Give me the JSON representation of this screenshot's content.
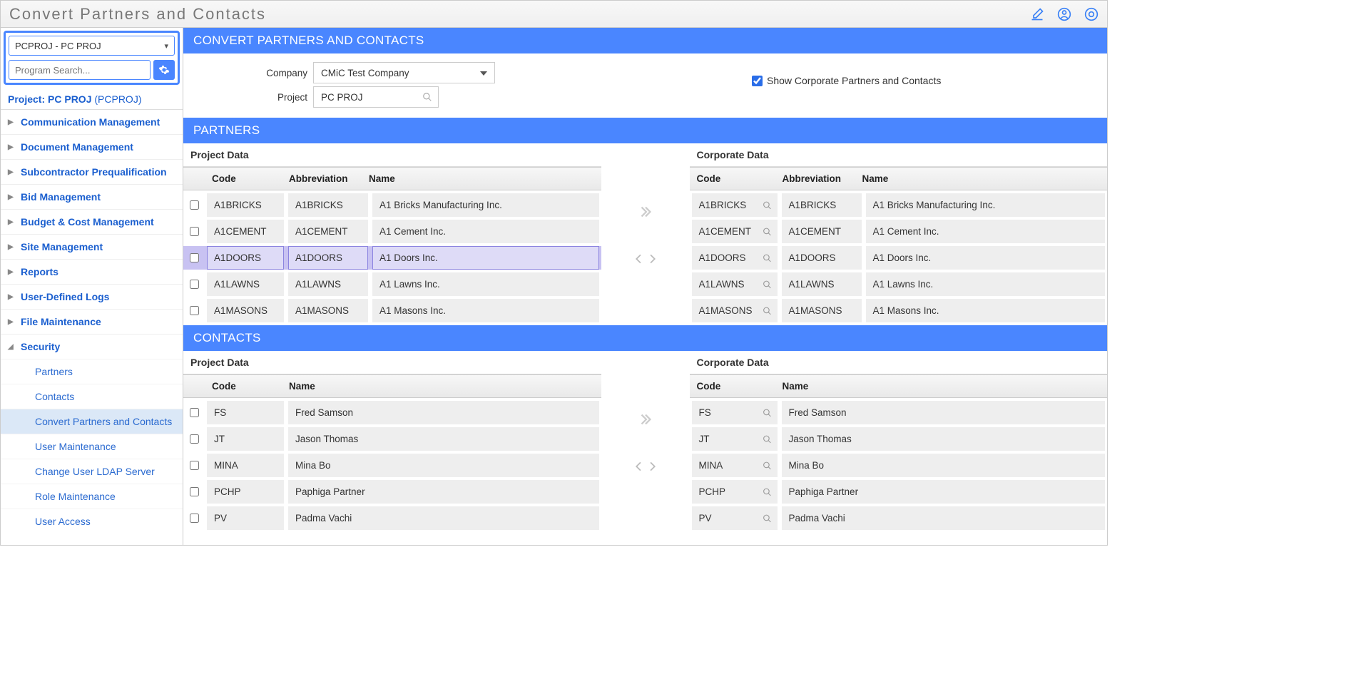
{
  "titlebar": {
    "title": "Convert Partners and Contacts"
  },
  "sidebar": {
    "project_select": "PCPROJ - PC PROJ",
    "search_placeholder": "Program Search...",
    "project_label": "Project: PC PROJ ",
    "project_paren": "(PCPROJ)",
    "items": [
      {
        "label": "Communication Management"
      },
      {
        "label": "Document Management"
      },
      {
        "label": "Subcontractor Prequalification"
      },
      {
        "label": "Bid Management"
      },
      {
        "label": "Budget & Cost Management"
      },
      {
        "label": "Site Management"
      },
      {
        "label": "Reports"
      },
      {
        "label": "User-Defined Logs"
      },
      {
        "label": "File Maintenance"
      }
    ],
    "security_label": "Security",
    "security_children": [
      {
        "label": "Partners"
      },
      {
        "label": "Contacts"
      },
      {
        "label": "Convert Partners and Contacts"
      },
      {
        "label": "User Maintenance"
      },
      {
        "label": "Change User LDAP Server"
      },
      {
        "label": "Role Maintenance"
      },
      {
        "label": "User Access"
      }
    ]
  },
  "headers": {
    "convert": "CONVERT PARTNERS AND CONTACTS",
    "partners": "PARTNERS",
    "contacts": "CONTACTS"
  },
  "form": {
    "company_label": "Company",
    "company_value": "CMiC Test Company",
    "project_label": "Project",
    "project_value": "PC PROJ",
    "show_corporate_label": "Show Corporate Partners and Contacts"
  },
  "panels": {
    "project_data": "Project Data",
    "corporate_data": "Corporate Data"
  },
  "cols": {
    "code": "Code",
    "abbreviation": "Abbreviation",
    "name": "Name"
  },
  "partners_project": [
    {
      "code": "A1BRICKS",
      "abbr": "A1BRICKS",
      "name": "A1 Bricks Manufacturing Inc."
    },
    {
      "code": "A1CEMENT",
      "abbr": "A1CEMENT",
      "name": "A1 Cement Inc."
    },
    {
      "code": "A1DOORS",
      "abbr": "A1DOORS",
      "name": "A1 Doors Inc."
    },
    {
      "code": "A1LAWNS",
      "abbr": "A1LAWNS",
      "name": "A1 Lawns Inc."
    },
    {
      "code": "A1MASONS",
      "abbr": "A1MASONS",
      "name": "A1 Masons Inc."
    }
  ],
  "partners_corporate": [
    {
      "code": "A1BRICKS",
      "abbr": "A1BRICKS",
      "name": "A1 Bricks Manufacturing Inc."
    },
    {
      "code": "A1CEMENT",
      "abbr": "A1CEMENT",
      "name": "A1 Cement Inc."
    },
    {
      "code": "A1DOORS",
      "abbr": "A1DOORS",
      "name": "A1 Doors Inc."
    },
    {
      "code": "A1LAWNS",
      "abbr": "A1LAWNS",
      "name": "A1 Lawns Inc."
    },
    {
      "code": "A1MASONS",
      "abbr": "A1MASONS",
      "name": "A1 Masons Inc."
    }
  ],
  "contacts_project": [
    {
      "code": "FS",
      "name": "Fred Samson"
    },
    {
      "code": "JT",
      "name": "Jason Thomas"
    },
    {
      "code": "MINA",
      "name": "Mina Bo"
    },
    {
      "code": "PCHP",
      "name": "Paphiga Partner"
    },
    {
      "code": "PV",
      "name": "Padma Vachi"
    }
  ],
  "contacts_corporate": [
    {
      "code": "FS",
      "name": "Fred Samson"
    },
    {
      "code": "JT",
      "name": "Jason Thomas"
    },
    {
      "code": "MINA",
      "name": "Mina Bo"
    },
    {
      "code": "PCHP",
      "name": "Paphiga Partner"
    },
    {
      "code": "PV",
      "name": "Padma Vachi"
    }
  ]
}
